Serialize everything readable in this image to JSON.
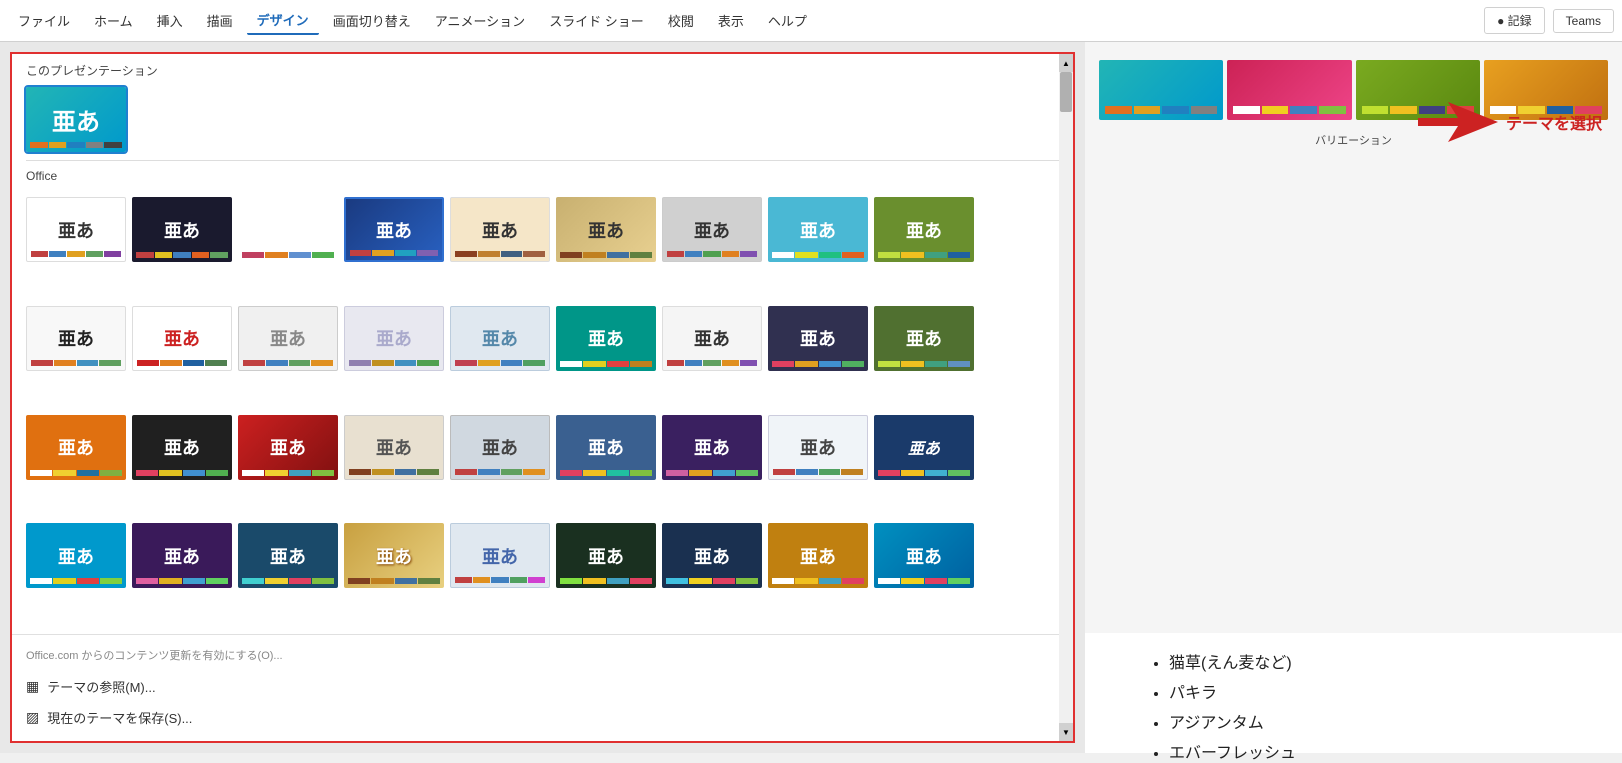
{
  "menubar": {
    "items": [
      {
        "label": "ファイル",
        "active": false
      },
      {
        "label": "ホーム",
        "active": false
      },
      {
        "label": "挿入",
        "active": false
      },
      {
        "label": "描画",
        "active": false
      },
      {
        "label": "デザイン",
        "active": true
      },
      {
        "label": "画面切り替え",
        "active": false
      },
      {
        "label": "アニメーション",
        "active": false
      },
      {
        "label": "スライド ショー",
        "active": false
      },
      {
        "label": "校閲",
        "active": false
      },
      {
        "label": "表示",
        "active": false
      },
      {
        "label": "ヘルプ",
        "active": false
      }
    ],
    "record_label": "● 記録",
    "teams_label": "Teams"
  },
  "theme_panel": {
    "current_section": "このプレゼンテーション",
    "office_section": "Office",
    "current_theme_label": "亜あ",
    "office_note": "Office.com からのコンテンツ更新を有効にする(O)...",
    "browse_label": "テーマの参照(M)...",
    "save_label": "現在のテーマを保存(S)..."
  },
  "variations": {
    "label": "バリエーション"
  },
  "annotation": {
    "text": "テーマを選択"
  },
  "slide_bullets": [
    "猫草(えん麦など)",
    "パキラ",
    "アジアンタム",
    "エバーフレッシュ"
  ]
}
